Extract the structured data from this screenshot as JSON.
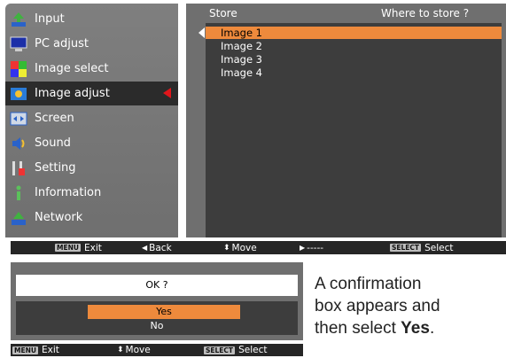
{
  "sidebar": {
    "items": [
      {
        "label": "Input",
        "icon": "input-icon"
      },
      {
        "label": "PC adjust",
        "icon": "pc-adjust-icon"
      },
      {
        "label": "Image select",
        "icon": "image-select-icon"
      },
      {
        "label": "Image adjust",
        "icon": "image-adjust-icon",
        "selected": true
      },
      {
        "label": "Screen",
        "icon": "screen-icon"
      },
      {
        "label": "Sound",
        "icon": "sound-icon"
      },
      {
        "label": "Setting",
        "icon": "setting-icon"
      },
      {
        "label": "Information",
        "icon": "information-icon"
      },
      {
        "label": "Network",
        "icon": "network-icon"
      }
    ]
  },
  "submenu": {
    "title": "Store",
    "hint": "Where to store ?",
    "options": [
      "Image 1",
      "Image 2",
      "Image 3",
      "Image 4"
    ],
    "active_index": 0
  },
  "status_bar": {
    "menu_badge": "MENU",
    "exit": "Exit",
    "back": "Back",
    "move": "Move",
    "next": "-----",
    "select_badge": "SELECT",
    "select": "Select"
  },
  "confirm": {
    "prompt": "OK ?",
    "options": [
      "Yes",
      "No"
    ],
    "active_index": 0,
    "status": {
      "menu_badge": "MENU",
      "exit": "Exit",
      "move": "Move",
      "select_badge": "SELECT",
      "select": "Select"
    }
  },
  "caption": {
    "line1": "A confirmation",
    "line2": "box appears and",
    "line3_prefix": "then select ",
    "line3_bold": "Yes",
    "line3_suffix": "."
  },
  "colors": {
    "highlight": "#ee8a3c",
    "selected_arrow": "#e0161b",
    "panel": "#6f6f6f",
    "panel_dark": "#3d3d3d",
    "bar": "#262626"
  }
}
